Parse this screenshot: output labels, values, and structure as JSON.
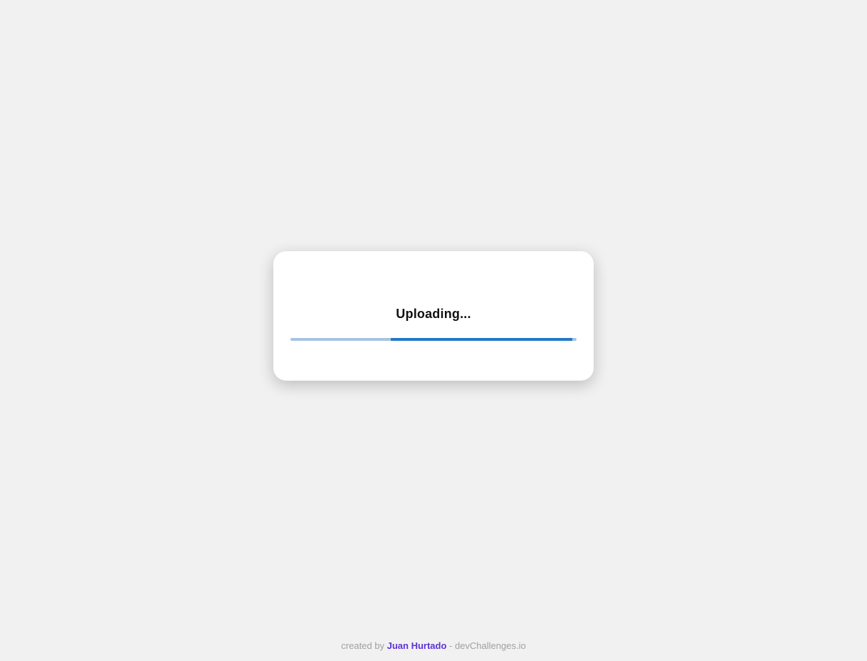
{
  "upload": {
    "status_text": "Uploading...",
    "progress": {
      "indeterminate": true,
      "segment_start_fraction": 0.35,
      "segment_end_fraction": 0.985
    }
  },
  "footer": {
    "prefix": "created by ",
    "author": "Juan Hurtado",
    "suffix": " - devChallenges.io"
  },
  "colors": {
    "background": "#f1f1f1",
    "card": "#ffffff",
    "track": "#a6c4e3",
    "fill": "#2479c8",
    "author": "#5d32d6"
  }
}
